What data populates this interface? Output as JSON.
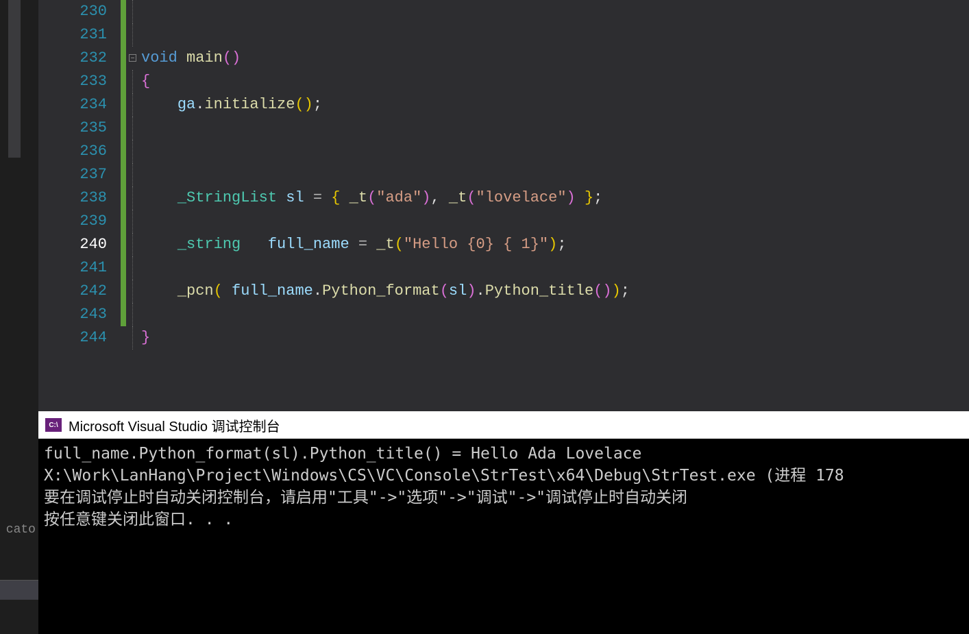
{
  "editor": {
    "lines": [
      {
        "n": "230",
        "current": false,
        "bar": "green",
        "outline": "line",
        "tokens": []
      },
      {
        "n": "231",
        "current": false,
        "bar": "green",
        "outline": "line",
        "tokens": []
      },
      {
        "n": "232",
        "current": false,
        "bar": "green",
        "outline": "box",
        "tokens": [
          {
            "t": "void ",
            "c": "kw"
          },
          {
            "t": "main",
            "c": "fn"
          },
          {
            "t": "()",
            "c": "paren-pink"
          }
        ]
      },
      {
        "n": "233",
        "current": false,
        "bar": "green",
        "outline": "line",
        "tokens": [
          {
            "t": "{",
            "c": "brace"
          }
        ]
      },
      {
        "n": "234",
        "current": false,
        "bar": "green",
        "outline": "line",
        "tokens": [
          {
            "t": "    ",
            "c": "punct"
          },
          {
            "t": "ga",
            "c": "ident-var"
          },
          {
            "t": ".",
            "c": "punct"
          },
          {
            "t": "initialize",
            "c": "member-call"
          },
          {
            "t": "()",
            "c": "paren"
          },
          {
            "t": ";",
            "c": "punct"
          }
        ]
      },
      {
        "n": "235",
        "current": false,
        "bar": "green",
        "outline": "line",
        "tokens": []
      },
      {
        "n": "236",
        "current": false,
        "bar": "green",
        "outline": "line",
        "tokens": []
      },
      {
        "n": "237",
        "current": false,
        "bar": "green",
        "outline": "line",
        "tokens": []
      },
      {
        "n": "238",
        "current": false,
        "bar": "green",
        "outline": "line",
        "tokens": [
          {
            "t": "    ",
            "c": "punct"
          },
          {
            "t": "_StringList ",
            "c": "type-name"
          },
          {
            "t": "sl ",
            "c": "ident-var"
          },
          {
            "t": "= ",
            "c": "op"
          },
          {
            "t": "{ ",
            "c": "paren"
          },
          {
            "t": "_t",
            "c": "fn"
          },
          {
            "t": "(",
            "c": "paren-pink"
          },
          {
            "t": "\"ada\"",
            "c": "string"
          },
          {
            "t": ")",
            "c": "paren-pink"
          },
          {
            "t": ", ",
            "c": "punct"
          },
          {
            "t": "_t",
            "c": "fn"
          },
          {
            "t": "(",
            "c": "paren-pink"
          },
          {
            "t": "\"lovelace\"",
            "c": "string"
          },
          {
            "t": ")",
            "c": "paren-pink"
          },
          {
            "t": " }",
            "c": "paren"
          },
          {
            "t": ";",
            "c": "punct"
          }
        ]
      },
      {
        "n": "239",
        "current": false,
        "bar": "green",
        "outline": "line",
        "tokens": []
      },
      {
        "n": "240",
        "current": true,
        "bar": "green",
        "outline": "line",
        "tokens": [
          {
            "t": "    ",
            "c": "punct"
          },
          {
            "t": "_string   ",
            "c": "type-name"
          },
          {
            "t": "full_name ",
            "c": "ident-var"
          },
          {
            "t": "= ",
            "c": "op"
          },
          {
            "t": "_t",
            "c": "fn"
          },
          {
            "t": "(",
            "c": "paren"
          },
          {
            "t": "\"Hello {0} { 1}\"",
            "c": "string"
          },
          {
            "t": ")",
            "c": "paren"
          },
          {
            "t": ";",
            "c": "punct"
          }
        ]
      },
      {
        "n": "241",
        "current": false,
        "bar": "green",
        "outline": "line",
        "tokens": []
      },
      {
        "n": "242",
        "current": false,
        "bar": "green",
        "outline": "line",
        "tokens": [
          {
            "t": "    ",
            "c": "punct"
          },
          {
            "t": "_pcn",
            "c": "fn"
          },
          {
            "t": "( ",
            "c": "paren"
          },
          {
            "t": "full_name",
            "c": "ident-var"
          },
          {
            "t": ".",
            "c": "punct"
          },
          {
            "t": "Python_format",
            "c": "member-call"
          },
          {
            "t": "(",
            "c": "paren-pink"
          },
          {
            "t": "sl",
            "c": "ident-var"
          },
          {
            "t": ")",
            "c": "paren-pink"
          },
          {
            "t": ".",
            "c": "punct"
          },
          {
            "t": "Python_title",
            "c": "member-call"
          },
          {
            "t": "()",
            "c": "paren-pink"
          },
          {
            "t": ")",
            "c": "paren"
          },
          {
            "t": ";",
            "c": "punct"
          }
        ]
      },
      {
        "n": "243",
        "current": false,
        "bar": "green",
        "outline": "line",
        "tokens": []
      },
      {
        "n": "244",
        "current": false,
        "bar": "",
        "outline": "line",
        "tokens": [
          {
            "t": "}",
            "c": "brace"
          }
        ]
      }
    ]
  },
  "console": {
    "icon_text": "C:\\",
    "title": "Microsoft Visual Studio 调试控制台",
    "lines": [
      "full_name.Python_format(sl).Python_title() = Hello Ada Lovelace",
      "",
      "X:\\Work\\LanHang\\Project\\Windows\\CS\\VC\\Console\\StrTest\\x64\\Debug\\StrTest.exe (进程 178",
      "要在调试停止时自动关闭控制台，请启用\"工具\"->\"选项\"->\"调试\"->\"调试停止时自动关闭",
      "按任意键关闭此窗口. . ."
    ]
  },
  "left_truncated_text": "cato"
}
